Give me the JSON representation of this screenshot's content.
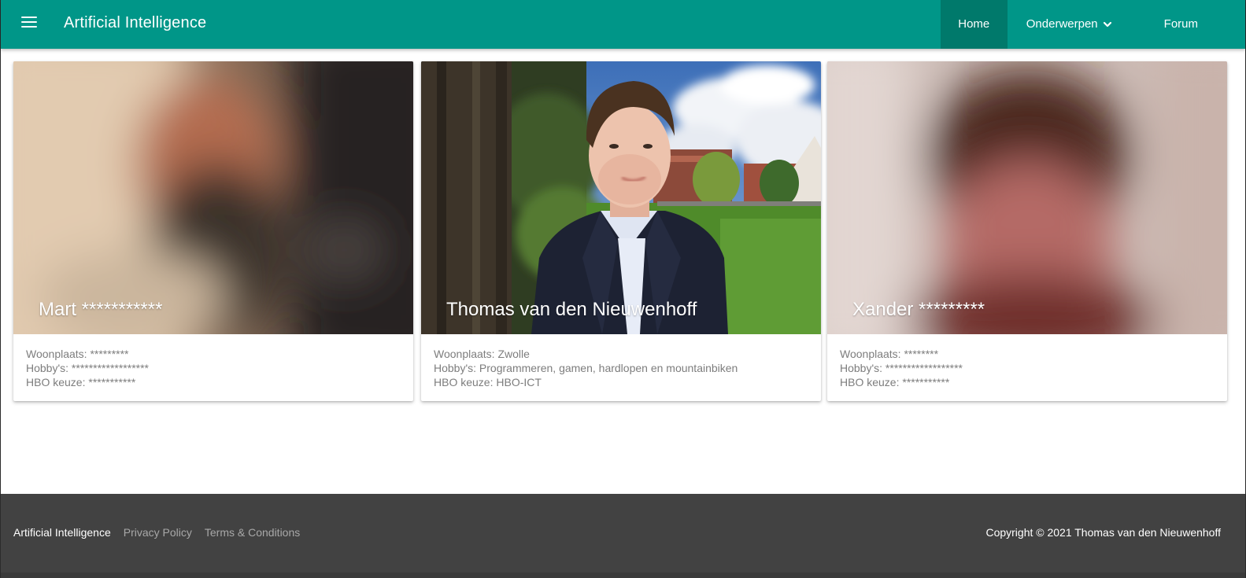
{
  "navbar": {
    "brand": "Artificial Intelligence",
    "items": [
      {
        "label": "Home",
        "active": true
      },
      {
        "label": "Onderwerpen",
        "has_dropdown": true
      },
      {
        "label": "Forum"
      }
    ],
    "color": "#009688",
    "active_color": "#00796b"
  },
  "cards": [
    {
      "name": "Mart ***********",
      "woonplaats": "Woonplaats: *********",
      "hobbys": "Hobby's: ******************",
      "hbo": "HBO keuze: ***********",
      "image_desc": "blurred-portrait"
    },
    {
      "name": "Thomas van den Nieuwenhoff",
      "woonplaats": "Woonplaats: Zwolle",
      "hobbys": "Hobby's: Programmeren, gamen, hardlopen en mountainbiken",
      "hbo": "HBO keuze: HBO-ICT",
      "image_desc": "portrait-photo"
    },
    {
      "name": "Xander *********",
      "woonplaats": "Woonplaats: ********",
      "hobbys": "Hobby's: ******************",
      "hbo": "HBO keuze: ***********",
      "image_desc": "blurred-portrait"
    }
  ],
  "footer": {
    "brand": "Artificial Intelligence",
    "links": [
      "Privacy Policy",
      "Terms & Conditions"
    ],
    "copyright": "Copyright © 2021 Thomas van den Nieuwenhoff",
    "background": "#424242"
  }
}
